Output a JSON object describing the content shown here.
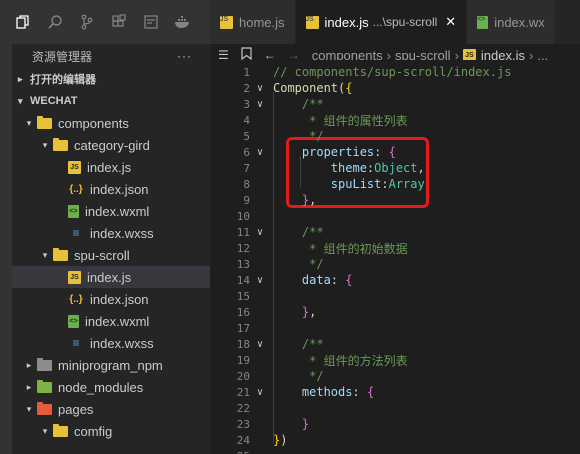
{
  "sidebar": {
    "title": "资源管理器",
    "more_label": "···",
    "sections": {
      "open_editors": "打开的编辑器",
      "project": "WECHAT"
    },
    "tree": [
      {
        "label": "components",
        "kind": "folder-open",
        "depth": 1,
        "arrow": "▾"
      },
      {
        "label": "category-gird",
        "kind": "folder-open",
        "depth": 2,
        "arrow": "▾"
      },
      {
        "label": "index.js",
        "kind": "js",
        "depth": 3
      },
      {
        "label": "index.json",
        "kind": "json",
        "depth": 3
      },
      {
        "label": "index.wxml",
        "kind": "wxml",
        "depth": 3
      },
      {
        "label": "index.wxss",
        "kind": "wxss",
        "depth": 3
      },
      {
        "label": "spu-scroll",
        "kind": "folder-open",
        "depth": 2,
        "arrow": "▾"
      },
      {
        "label": "index.js",
        "kind": "js",
        "depth": 3,
        "active": true
      },
      {
        "label": "index.json",
        "kind": "json",
        "depth": 3
      },
      {
        "label": "index.wxml",
        "kind": "wxml",
        "depth": 3
      },
      {
        "label": "index.wxss",
        "kind": "wxss",
        "depth": 3
      },
      {
        "label": "miniprogram_npm",
        "kind": "folder",
        "depth": 1,
        "arrow": "▸"
      },
      {
        "label": "node_modules",
        "kind": "folder-green",
        "depth": 1,
        "arrow": "▸"
      },
      {
        "label": "pages",
        "kind": "folder-red",
        "depth": 1,
        "arrow": "▾"
      },
      {
        "label": "comfig",
        "kind": "folder-open",
        "depth": 2,
        "arrow": "▾"
      }
    ]
  },
  "tabs": [
    {
      "label": "home.js",
      "icon": "JS",
      "active": false
    },
    {
      "label": "index.js",
      "suffix": "...\\spu-scroll",
      "icon": "JS",
      "active": true,
      "close": "✕"
    },
    {
      "label": "index.wx",
      "icon": "<>",
      "active": false
    }
  ],
  "breadcrumb": {
    "parts": [
      "components",
      "spu-scroll",
      "index.js"
    ],
    "tail": "..."
  },
  "editor": {
    "lines": [
      {
        "n": "1",
        "tokens": [
          {
            "t": "// components/sup-scroll/index.js",
            "c": "c-comment"
          }
        ]
      },
      {
        "n": "2",
        "fold": "∨",
        "tokens": [
          {
            "t": "Component",
            "c": "c-fn"
          },
          {
            "t": "(",
            "c": "c-punc"
          },
          {
            "t": "{",
            "c": "c-brace"
          }
        ]
      },
      {
        "n": "3",
        "fold": "∨",
        "tokens": [
          {
            "t": "    /**",
            "c": "c-comment"
          }
        ]
      },
      {
        "n": "4",
        "tokens": [
          {
            "t": "     * 组件的属性列表",
            "c": "c-comment"
          }
        ]
      },
      {
        "n": "5",
        "tokens": [
          {
            "t": "     */",
            "c": "c-comment"
          }
        ]
      },
      {
        "n": "6",
        "fold": "∨",
        "tokens": [
          {
            "t": "    properties",
            "c": "c-prop"
          },
          {
            "t": ": ",
            "c": "c-punc"
          },
          {
            "t": "{",
            "c": "c-brace2"
          }
        ]
      },
      {
        "n": "7",
        "tokens": [
          {
            "t": "        theme",
            "c": "c-prop"
          },
          {
            "t": ":",
            "c": "c-punc"
          },
          {
            "t": "Object",
            "c": "c-type"
          },
          {
            "t": ",",
            "c": "c-punc"
          }
        ]
      },
      {
        "n": "8",
        "tokens": [
          {
            "t": "        spuList",
            "c": "c-prop"
          },
          {
            "t": ":",
            "c": "c-punc"
          },
          {
            "t": "Array",
            "c": "c-type"
          }
        ]
      },
      {
        "n": "9",
        "tokens": [
          {
            "t": "    ",
            "c": "c-punc"
          },
          {
            "t": "}",
            "c": "c-brace2"
          },
          {
            "t": ",",
            "c": "c-punc"
          }
        ]
      },
      {
        "n": "10",
        "tokens": []
      },
      {
        "n": "11",
        "fold": "∨",
        "tokens": [
          {
            "t": "    /**",
            "c": "c-comment"
          }
        ]
      },
      {
        "n": "12",
        "tokens": [
          {
            "t": "     * 组件的初始数据",
            "c": "c-comment"
          }
        ]
      },
      {
        "n": "13",
        "tokens": [
          {
            "t": "     */",
            "c": "c-comment"
          }
        ]
      },
      {
        "n": "14",
        "fold": "∨",
        "tokens": [
          {
            "t": "    data",
            "c": "c-prop"
          },
          {
            "t": ": ",
            "c": "c-punc"
          },
          {
            "t": "{",
            "c": "c-brace2"
          }
        ]
      },
      {
        "n": "15",
        "tokens": []
      },
      {
        "n": "16",
        "tokens": [
          {
            "t": "    ",
            "c": "c-punc"
          },
          {
            "t": "}",
            "c": "c-brace2"
          },
          {
            "t": ",",
            "c": "c-punc"
          }
        ]
      },
      {
        "n": "17",
        "tokens": []
      },
      {
        "n": "18",
        "fold": "∨",
        "tokens": [
          {
            "t": "    /**",
            "c": "c-comment"
          }
        ]
      },
      {
        "n": "19",
        "tokens": [
          {
            "t": "     * 组件的方法列表",
            "c": "c-comment"
          }
        ]
      },
      {
        "n": "20",
        "tokens": [
          {
            "t": "     */",
            "c": "c-comment"
          }
        ]
      },
      {
        "n": "21",
        "fold": "∨",
        "tokens": [
          {
            "t": "    methods",
            "c": "c-prop"
          },
          {
            "t": ": ",
            "c": "c-punc"
          },
          {
            "t": "{",
            "c": "c-brace2"
          }
        ]
      },
      {
        "n": "22",
        "tokens": []
      },
      {
        "n": "23",
        "tokens": [
          {
            "t": "    ",
            "c": "c-punc"
          },
          {
            "t": "}",
            "c": "c-brace2"
          }
        ]
      },
      {
        "n": "24",
        "tokens": [
          {
            "t": "}",
            "c": "c-brace"
          },
          {
            "t": ")",
            "c": "c-punc"
          }
        ]
      },
      {
        "n": "25",
        "tokens": []
      }
    ]
  },
  "colors": {
    "highlight_box": "#e31b1b",
    "accent_js": "#e8c13a"
  }
}
